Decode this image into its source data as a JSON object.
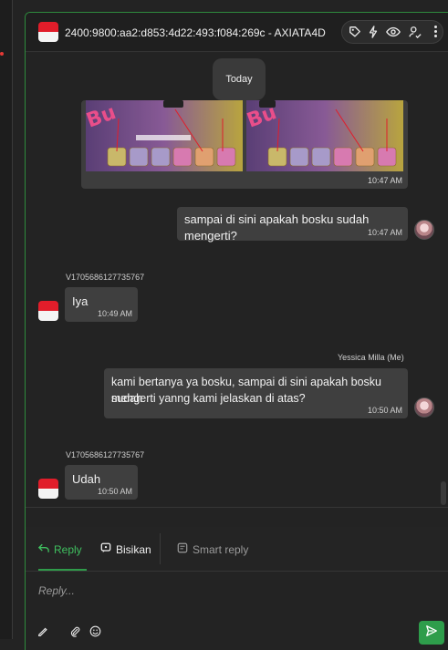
{
  "header": {
    "title": "2400:9800:aa2:d853:4d22:493:f084:269c - AXIATA4D",
    "actions": [
      "tag-icon",
      "bolt-icon",
      "eye-icon",
      "assign-icon"
    ],
    "more": "kebab-icon"
  },
  "chat": {
    "day_label": "Today",
    "image_message": {
      "time": "10:47 AM"
    },
    "messages": [
      {
        "text": "sampai di sini apakah bosku sudah mengerti?",
        "time": "10:47 AM"
      },
      {
        "sender": "V1705686127735767",
        "text": "Iya",
        "time": "10:49 AM"
      },
      {
        "sender": "Yessica Milla (Me)",
        "text_line1": "kami bertanya ya bosku, sampai di sini apakah bosku sudah",
        "text_line2": "mengerti yanng kami jelaskan di atas?",
        "time": "10:50 AM"
      },
      {
        "sender": "V1705686127735767",
        "text": "Udah",
        "time": "10:50 AM"
      }
    ]
  },
  "tabs": {
    "reply": "Reply",
    "bisikan": "Bisikan",
    "smart_reply": "Smart reply"
  },
  "composer": {
    "placeholder": "Reply...",
    "icons": [
      "pen-icon",
      "attach-icon",
      "emoji-icon",
      "send-icon"
    ]
  },
  "colors": {
    "accent": "#2e9d4b",
    "background": "#232323",
    "bubble": "#3f3f3f"
  }
}
